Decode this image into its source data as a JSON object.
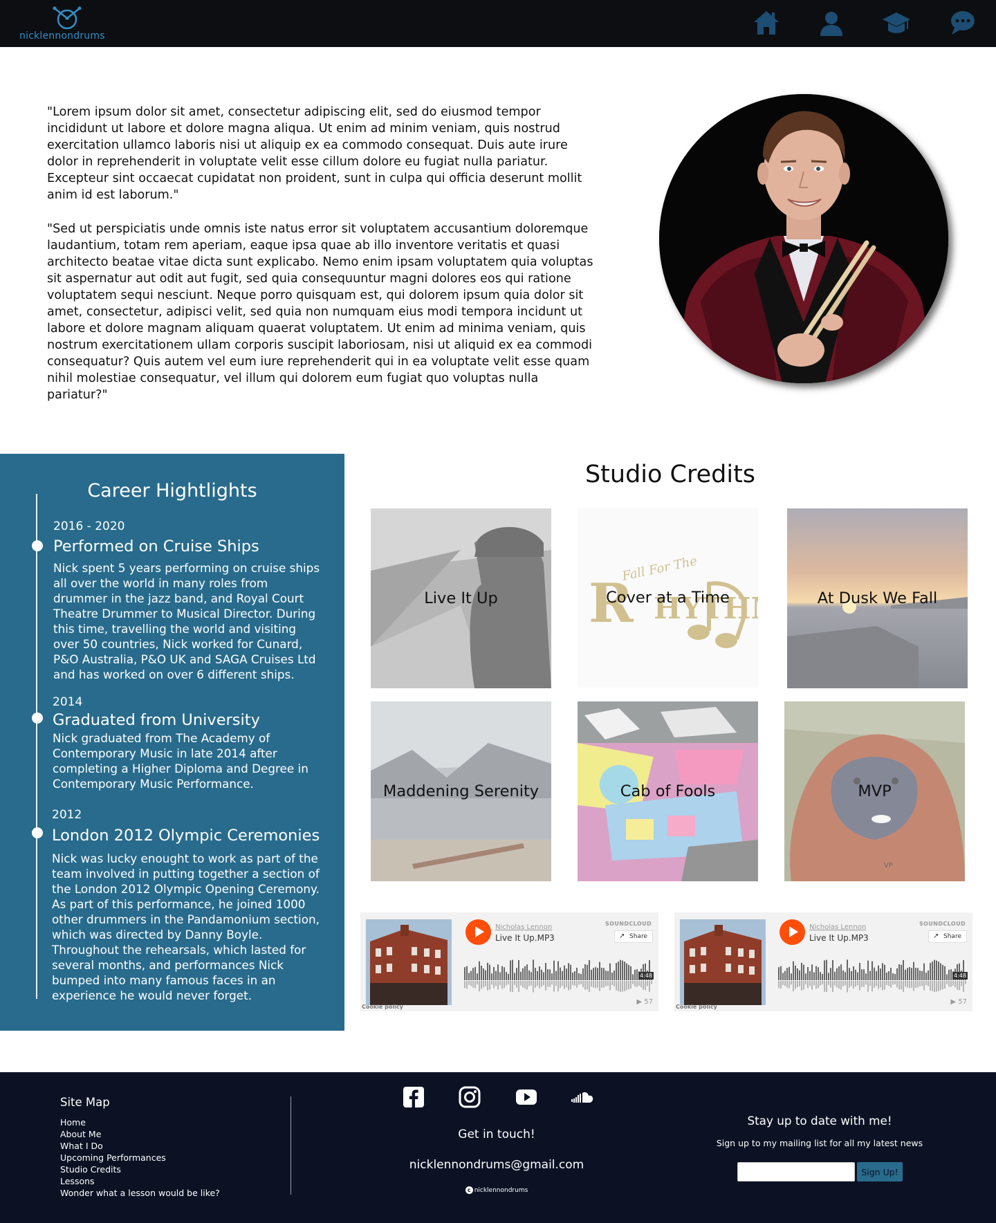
{
  "header": {
    "logo_text": "nicklennondrums",
    "accent_color": "#2f8fc6",
    "nav": [
      {
        "icon": "home-icon"
      },
      {
        "icon": "user-icon"
      },
      {
        "icon": "graduation-cap-icon"
      },
      {
        "icon": "chat-icon"
      }
    ]
  },
  "bio": {
    "paragraph_1": "\"Lorem ipsum dolor sit amet, consectetur adipiscing elit, sed do eiusmod tempor incididunt ut labore et dolore magna aliqua. Ut enim ad minim veniam, quis nostrud exercitation ullamco laboris nisi ut aliquip ex ea commodo consequat. Duis aute irure dolor in reprehenderit in voluptate velit esse cillum dolore eu fugiat nulla pariatur. Excepteur sint occaecat cupidatat non proident, sunt in culpa qui officia deserunt mollit anim id est laborum.\"",
    "paragraph_2": "\"Sed ut perspiciatis unde omnis iste natus error sit voluptatem accusantium doloremque laudantium, totam rem aperiam, eaque ipsa quae ab illo inventore veritatis et quasi architecto beatae vitae dicta sunt explicabo. Nemo enim ipsam voluptatem quia voluptas sit aspernatur aut odit aut fugit, sed quia consequuntur magni dolores eos qui ratione voluptatem sequi nesciunt. Neque porro quisquam est, qui dolorem ipsum quia dolor sit amet, consectetur, adipisci velit, sed quia non numquam eius modi tempora incidunt ut labore et dolore magnam aliquam quaerat voluptatem. Ut enim ad minima veniam, quis nostrum exercitationem ullam corporis suscipit laboriosam, nisi ut aliquid ex ea commodi consequatur? Quis autem vel eum iure reprehenderit qui in ea voluptate velit esse quam nihil molestiae consequatur, vel illum qui dolorem eum fugiat quo voluptas nulla pariatur?\""
  },
  "career": {
    "title": "Career Hightlights",
    "panel_color": "#286b8c",
    "items": [
      {
        "year": "2016 - 2020",
        "heading": "Performed on Cruise Ships",
        "body": "Nick spent 5 years performing on  cruise ships all over the world in many roles from drummer in the jazz band, and Royal Court Theatre Drummer to Musical Director. During this time, travelling the world and visiting over 50 countries, Nick worked for Cunard, P&O Australia, P&O UK and SAGA Cruises Ltd and has worked on over 6 different ships."
      },
      {
        "year": "2014",
        "heading": "Graduated from University",
        "body": "Nick graduated from The Academy of Contemporary Music in late 2014 after completing a Higher Diploma and Degree in Contemporary Music Performance."
      },
      {
        "year": "2012",
        "heading": "London 2012 Olympic Ceremonies",
        "body": "Nick was lucky enought to work as part of the team involved in putting together a section of the London 2012 Olympic Opening Ceremony. As part of this performance, he joined 1000 other drummers in the Pandamonium section, which was directed by Danny Boyle. Throughout the rehearsals, which lasted for several months, and performances Nick bumped into many famous faces in an experience he would never forget."
      }
    ]
  },
  "studio": {
    "title": "Studio Credits",
    "tiles": [
      {
        "caption": "Live It Up"
      },
      {
        "caption": "Cover at a Time"
      },
      {
        "caption": "At Dusk We Fall"
      },
      {
        "caption": "Maddening Serenity"
      },
      {
        "caption": "Cab of Fools"
      },
      {
        "caption": "MVP"
      }
    ],
    "cover_text_rhythm": "Fall For The",
    "cover_text_vp": "VP"
  },
  "players": [
    {
      "artist": "Nicholas Lennon",
      "track": "Live It Up.MP3",
      "brand": "SOUNDCLOUD",
      "share": "Share",
      "duration": "4:48",
      "plays": "▶ 57",
      "cookie": "Cookie policy"
    },
    {
      "artist": "Nicholas Lennon",
      "track": "Live It Up.MP3",
      "brand": "SOUNDCLOUD",
      "share": "Share",
      "duration": "4:48",
      "plays": "▶ 57",
      "cookie": "Cookie policy"
    }
  ],
  "footer": {
    "sitemap_title": "Site Map",
    "sitemap": [
      "Home",
      "About Me",
      "What I Do",
      "Upcoming Performances",
      "Studio Credits",
      "Lessons",
      "Wonder what a lesson would be like?"
    ],
    "socials": [
      "facebook-icon",
      "instagram-icon",
      "youtube-icon",
      "soundcloud-icon"
    ],
    "get_in_touch": "Get in touch!",
    "email": "nicklennondrums@gmail.com",
    "copyright": "nicklennondrums",
    "stay_title": "Stay up to date with me!",
    "signup_text": "Sign up to my mailing list for all my latest news",
    "input_placeholder": "",
    "signup_button": "Sign Up!"
  }
}
